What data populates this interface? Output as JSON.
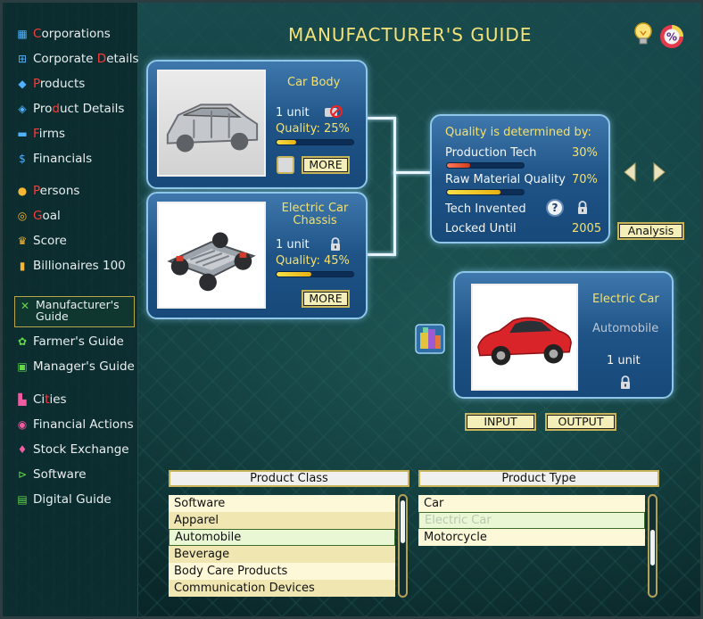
{
  "sidebar": {
    "items": [
      {
        "pre": "",
        "hl": "C",
        "post": "orporations",
        "icon": "building-icon",
        "color": "#4fb1ff"
      },
      {
        "pre": "Corporate ",
        "hl": "D",
        "post": "etails",
        "icon": "org-chart-icon",
        "color": "#4fb1ff"
      },
      {
        "pre": "",
        "hl": "P",
        "post": "roducts",
        "icon": "cube-icon",
        "color": "#4fb1ff"
      },
      {
        "pre": "Pro",
        "hl": "d",
        "post": "uct Details",
        "icon": "tag-icon",
        "color": "#4fb1ff"
      },
      {
        "pre": "",
        "hl": "F",
        "post": "irms",
        "icon": "shop-icon",
        "color": "#4fb1ff"
      },
      {
        "pre": "Financials",
        "hl": "",
        "post": "",
        "icon": "dollar-icon",
        "color": "#4fb1ff"
      },
      {
        "pre": "",
        "hl": "P",
        "post": "ersons",
        "icon": "person-icon",
        "color": "#f5b631"
      },
      {
        "pre": "",
        "hl": "G",
        "post": "oal",
        "icon": "target-icon",
        "color": "#f5b631"
      },
      {
        "pre": "Score",
        "hl": "",
        "post": "",
        "icon": "trophy-icon",
        "color": "#f5b631"
      },
      {
        "pre": "Billionaires 100",
        "hl": "",
        "post": "",
        "icon": "bar-chart-icon",
        "color": "#f5b631"
      },
      {
        "pre": "Manufacturer's Guide",
        "hl": "",
        "post": "",
        "icon": "tools-icon",
        "color": "#62d84a"
      },
      {
        "pre": "Farmer's Guide",
        "hl": "",
        "post": "",
        "icon": "plant-icon",
        "color": "#62d84a"
      },
      {
        "pre": "Manager's Guide",
        "hl": "",
        "post": "",
        "icon": "briefcase-icon",
        "color": "#62d84a"
      },
      {
        "pre": "Ci",
        "hl": "t",
        "post": "ies",
        "icon": "city-icon",
        "color": "#f05ca0"
      },
      {
        "pre": "Financial Actions",
        "hl": "",
        "post": "",
        "icon": "coin-icon",
        "color": "#f05ca0"
      },
      {
        "pre": "Stock Exchange",
        "hl": "",
        "post": "",
        "icon": "stock-icon",
        "color": "#f05ca0"
      },
      {
        "pre": "Software",
        "hl": "",
        "post": "",
        "icon": "code-icon",
        "color": "#62d84a"
      },
      {
        "pre": "Digital Guide",
        "hl": "",
        "post": "",
        "icon": "book-icon",
        "color": "#62d84a"
      }
    ]
  },
  "header": {
    "title": "MANUFACTURER'S GUIDE"
  },
  "inputs": [
    {
      "name": "Car Body",
      "units": "1 unit",
      "quality": "Quality: 25%",
      "quality_value": 0.25,
      "more": "MORE"
    },
    {
      "name": "Electric Car Chassis",
      "units": "1 unit",
      "quality": "Quality: 45%",
      "quality_value": 0.45,
      "more": "MORE"
    }
  ],
  "quality_panel": {
    "title": "Quality is determined by:",
    "production_tech_label": "Production Tech",
    "production_tech_value": "30%",
    "production_tech_fraction": 0.3,
    "raw_material_label": "Raw Material Quality",
    "raw_material_value": "70%",
    "raw_material_fraction": 0.7,
    "tech_invented_label": "Tech Invented",
    "help_glyph": "?",
    "locked_until_label": "Locked Until",
    "locked_until_value": "2005",
    "analysis_label": "Analysis"
  },
  "output": {
    "name": "Electric Car",
    "type": "Automobile",
    "units": "1 unit"
  },
  "toggle": {
    "input_label": "INPUT",
    "output_label": "OUTPUT"
  },
  "product_class": {
    "header": "Product Class",
    "items": [
      "Software",
      "Apparel",
      "Automobile",
      "Beverage",
      "Body Care Products",
      "Communication Devices"
    ],
    "selected": 2
  },
  "product_type": {
    "header": "Product Type",
    "items": [
      "Car",
      "Electric Car",
      "Motorcycle"
    ],
    "selected": 1
  },
  "colors": {
    "accent_gold": "#f4e06c",
    "bar_red": "#e0532d",
    "bar_yellow": "#f5d12a"
  }
}
